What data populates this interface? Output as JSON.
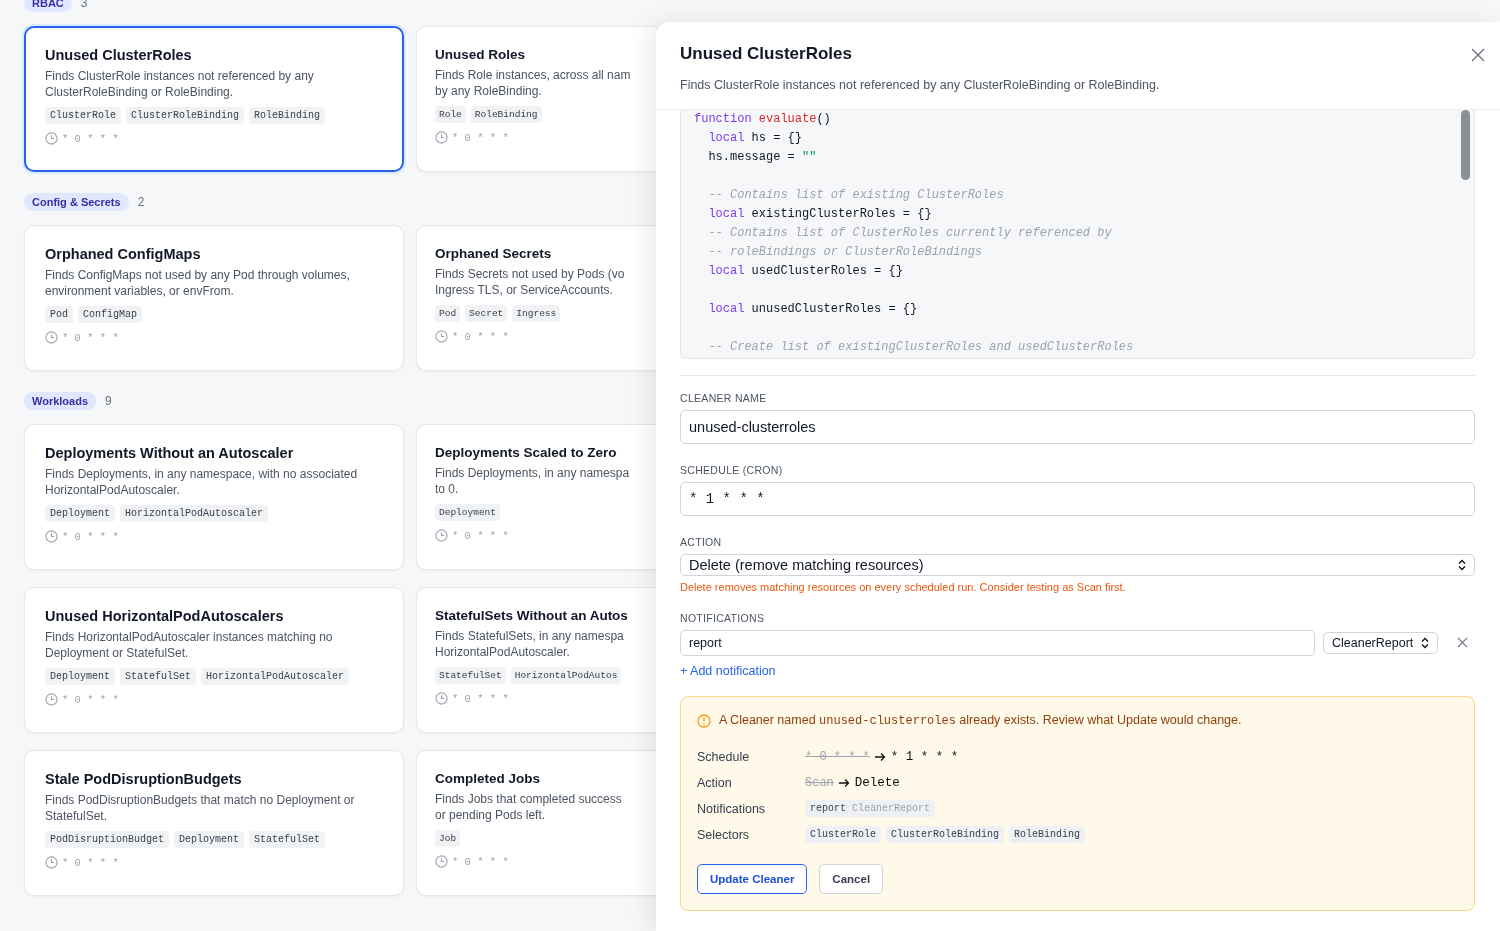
{
  "sections": [
    {
      "label": "RBAC",
      "count": "3",
      "cards": [
        {
          "title": "Unused ClusterRoles",
          "description": [
            "Finds ClusterRole instances not referenced by any",
            "ClusterRoleBinding or RoleBinding."
          ],
          "tags": [
            "ClusterRole",
            "ClusterRoleBinding",
            "RoleBinding"
          ],
          "schedule": "* 0 * * *",
          "selected": true
        },
        {
          "title": "Unused Roles",
          "description": [
            "Finds Role instances, across all nam",
            "by any RoleBinding."
          ],
          "tags": [
            "Role",
            "RoleBinding"
          ],
          "schedule": "* 0 * * *",
          "selected": false
        }
      ]
    },
    {
      "label": "Config & Secrets",
      "count": "2",
      "cards": [
        {
          "title": "Orphaned ConfigMaps",
          "description": [
            "Finds ConfigMaps not used by any Pod through volumes,",
            "environment variables, or envFrom."
          ],
          "tags": [
            "Pod",
            "ConfigMap"
          ],
          "schedule": "* 0 * * *",
          "selected": false
        },
        {
          "title": "Orphaned Secrets",
          "description": [
            "Finds Secrets not used by Pods (vo",
            "Ingress TLS, or ServiceAccounts."
          ],
          "tags": [
            "Pod",
            "Secret",
            "Ingress"
          ],
          "schedule": "* 0 * * *",
          "selected": false
        }
      ]
    },
    {
      "label": "Workloads",
      "count": "9",
      "cards": [
        {
          "title": "Deployments Without an Autoscaler",
          "description": [
            "Finds Deployments, in any namespace, with no associated",
            "HorizontalPodAutoscaler."
          ],
          "tags": [
            "Deployment",
            "HorizontalPodAutoscaler"
          ],
          "schedule": "* 0 * * *",
          "selected": false
        },
        {
          "title": "Deployments Scaled to Zero",
          "description": [
            "Finds Deployments, in any namespa",
            "to 0."
          ],
          "tags": [
            "Deployment"
          ],
          "schedule": "* 0 * * *",
          "selected": false
        },
        {
          "title": "Unused HorizontalPodAutoscalers",
          "description": [
            "Finds HorizontalPodAutoscaler instances matching no",
            "Deployment or StatefulSet."
          ],
          "tags": [
            "Deployment",
            "StatefulSet",
            "HorizontalPodAutoscaler"
          ],
          "schedule": "* 0 * * *",
          "selected": false
        },
        {
          "title": "StatefulSets Without an Autos",
          "description": [
            "Finds StatefulSets, in any namespa",
            "HorizontalPodAutoscaler."
          ],
          "tags": [
            "StatefulSet",
            "HorizontalPodAutos"
          ],
          "schedule": "* 0 * * *",
          "selected": false
        },
        {
          "title": "Stale PodDisruptionBudgets",
          "description": [
            "Finds PodDisruptionBudgets that match no Deployment or",
            "StatefulSet."
          ],
          "tags": [
            "PodDisruptionBudget",
            "Deployment",
            "StatefulSet"
          ],
          "schedule": "* 0 * * *",
          "selected": false
        },
        {
          "title": "Completed Jobs",
          "description": [
            "Finds Jobs that completed success",
            "or pending Pods left."
          ],
          "tags": [
            "Job"
          ],
          "schedule": "* 0 * * *",
          "selected": false
        }
      ]
    }
  ],
  "panel": {
    "title": "Unused ClusterRoles",
    "description": "Finds ClusterRole instances not referenced by any ClusterRoleBinding or RoleBinding.",
    "code": [
      {
        "blank_before": false,
        "segments": [
          {
            "kind": "keyword",
            "text": "function "
          },
          {
            "kind": "function",
            "text": "evaluate"
          },
          {
            "kind": "plain",
            "text": "()"
          }
        ]
      },
      {
        "blank_before": false,
        "segments": [
          {
            "kind": "keyword",
            "text": "  local "
          },
          {
            "kind": "plain",
            "text": "hs = {}"
          }
        ]
      },
      {
        "blank_before": false,
        "segments": [
          {
            "kind": "plain",
            "text": "  hs.message = "
          },
          {
            "kind": "string",
            "text": "\"\""
          }
        ]
      },
      {
        "blank_before": true,
        "segments": [
          {
            "kind": "comment",
            "text": "  -- Contains list of existing ClusterRoles"
          }
        ]
      },
      {
        "blank_before": false,
        "segments": [
          {
            "kind": "keyword",
            "text": "  local "
          },
          {
            "kind": "plain",
            "text": "existingClusterRoles = {}"
          }
        ]
      },
      {
        "blank_before": false,
        "segments": [
          {
            "kind": "comment",
            "text": "  -- Contains list of ClusterRoles currently referenced by"
          }
        ]
      },
      {
        "blank_before": false,
        "segments": [
          {
            "kind": "comment",
            "text": "  -- roleBindings or ClusterRoleBindings"
          }
        ]
      },
      {
        "blank_before": false,
        "segments": [
          {
            "kind": "keyword",
            "text": "  local "
          },
          {
            "kind": "plain",
            "text": "usedClusterRoles = {}"
          }
        ]
      },
      {
        "blank_before": true,
        "segments": [
          {
            "kind": "keyword",
            "text": "  local "
          },
          {
            "kind": "plain",
            "text": "unusedClusterRoles = {}"
          }
        ]
      },
      {
        "blank_before": true,
        "segments": [
          {
            "kind": "comment",
            "text": "  -- Create list of existingClusterRoles and usedClusterRoles"
          }
        ]
      }
    ],
    "name_label": "CLEANER NAME",
    "name_value": "unused-clusterroles",
    "schedule_label": "SCHEDULE (CRON)",
    "schedule_value": "* 1 * * *",
    "action_label": "ACTION",
    "action_value": "Delete (remove matching resources)",
    "action_warning": "Delete removes matching resources on every scheduled run. Consider testing as Scan first.",
    "notifications_label": "NOTIFICATIONS",
    "notifications": [
      {
        "name": "report",
        "type": "CleanerReport"
      }
    ],
    "add_notification": "+ Add notification",
    "alert": {
      "message_parts": [
        {
          "kind": "text",
          "text": "A Cleaner named "
        },
        {
          "kind": "code",
          "text": "unused-clusterroles"
        },
        {
          "kind": "text",
          "text": " already exists. Review what Update would change."
        }
      ],
      "rows": [
        {
          "label": "Schedule",
          "kind": "change",
          "old": "* 0 * * *",
          "new": "* 1 * * *"
        },
        {
          "label": "Action",
          "kind": "change",
          "old": "Scan",
          "new": "Delete"
        },
        {
          "label": "Notifications",
          "kind": "notification",
          "name": "report",
          "type": "CleanerReport"
        },
        {
          "label": "Selectors",
          "kind": "chips",
          "chips": [
            "ClusterRole",
            "ClusterRoleBinding",
            "RoleBinding"
          ]
        }
      ],
      "buttons": [
        {
          "label": "Update Cleaner",
          "kind": "primary"
        },
        {
          "label": "Cancel",
          "kind": "secondary"
        }
      ]
    }
  }
}
